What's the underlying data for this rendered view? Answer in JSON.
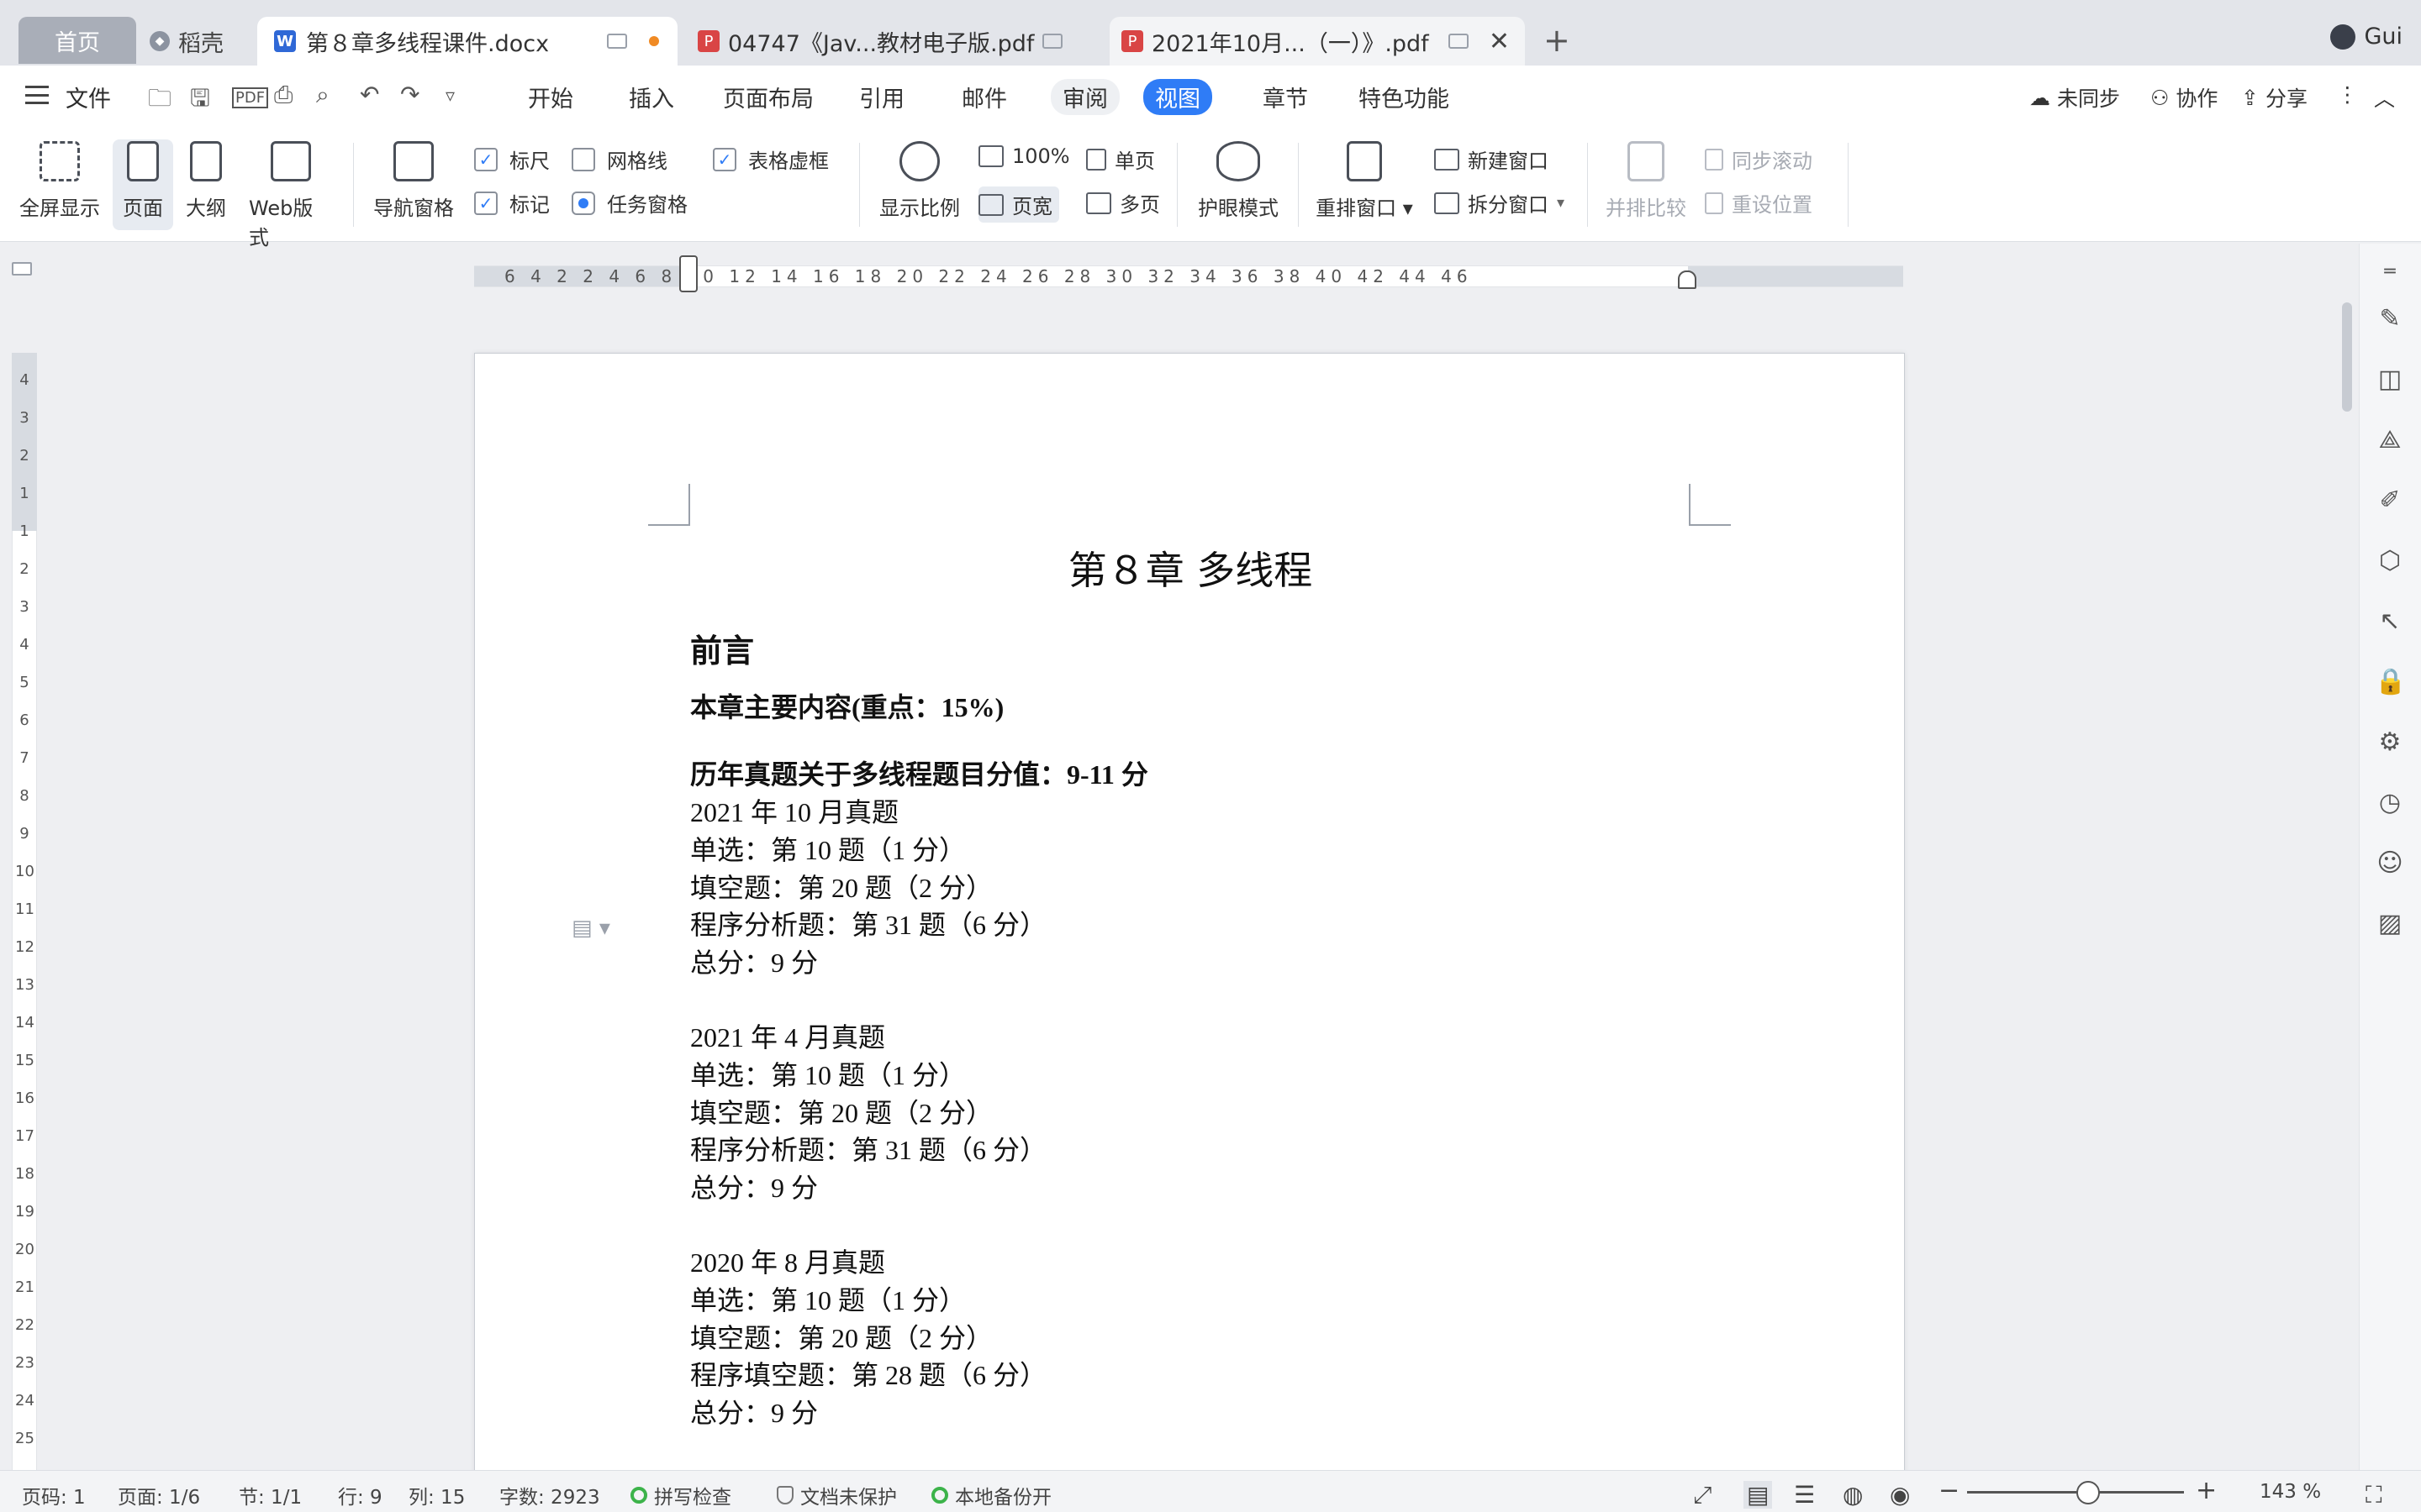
{
  "tabs": {
    "home": "首页",
    "daoke": "稻壳",
    "doc": "第８章多线程课件.docx",
    "pdf1": "04747《Jav...教材电子版.pdf",
    "pdf2": "2021年10月...（一）》.pdf",
    "new_tab": "+",
    "user": "Gui"
  },
  "menu": {
    "file": "文件",
    "items": [
      "开始",
      "插入",
      "页面布局",
      "引用",
      "邮件",
      "审阅",
      "视图",
      "章节",
      "特色功能"
    ],
    "active": "视图",
    "sync": "未同步",
    "collab": "协作",
    "share": "分享"
  },
  "ribbon": {
    "fullscreen": "全屏显示",
    "page": "页面",
    "outline": "大纲",
    "web": "Web版式",
    "nav_pane": "导航窗格",
    "ruler": "标尺",
    "gridlines": "网格线",
    "table_grid": "表格虚框",
    "marks": "标记",
    "task_pane": "任务窗格",
    "zoom": "显示比例",
    "hundred": "100%",
    "page_width": "页宽",
    "single_page": "单页",
    "multi_page": "多页",
    "eye_mode": "护眼模式",
    "rearrange": "重排窗口",
    "new_window": "新建窗口",
    "split_window": "拆分窗口",
    "side_by_side": "并排比较",
    "sync_scroll": "同步滚动",
    "reset_position": "重设位置"
  },
  "ruler": {
    "h_numbers": "6  4  2    2  4  6  8  10  12  14  16  18  20  22  24  26  28  30  32  34  36  38  40  42  44  46",
    "v_numbers": [
      "4",
      "3",
      "2",
      "1",
      "",
      "1",
      "2",
      "3",
      "4",
      "5",
      "6",
      "7",
      "8",
      "9",
      "10",
      "11",
      "12",
      "13",
      "14",
      "15",
      "16",
      "17",
      "18",
      "19",
      "20",
      "21",
      "22",
      "23",
      "24",
      "25"
    ]
  },
  "document": {
    "title": "第８章 多线程",
    "heading": "前言",
    "subheading1": "本章主要内容(重点：15%)",
    "subheading2": "历年真题关于多线程题目分值：9-11 分",
    "sections": [
      {
        "lines": [
          "2021 年 10 月真题",
          "单选：第 10 题（1 分）",
          "填空题：第 20 题（2 分）",
          "程序分析题：第 31 题（6 分）",
          "总分：9 分"
        ]
      },
      {
        "lines": [
          "2021 年 4 月真题",
          "单选：第 10 题（1 分）",
          "填空题：第 20 题（2 分）",
          "程序分析题：第 31 题（6 分）",
          "总分：9 分"
        ]
      },
      {
        "lines": [
          "2020 年 8 月真题",
          "单选：第 10 题（1 分）",
          "填空题：第 20 题（2 分）",
          "程序填空题：第 28 题（6 分）",
          "总分：9 分"
        ]
      }
    ]
  },
  "status": {
    "page_code": "页码: 1",
    "page": "页面: 1/6",
    "section": "节: 1/1",
    "row": "行: 9",
    "col": "列: 15",
    "word_count": "字数: 2923",
    "spell_check": "拼写检查",
    "doc_unprotected": "文档未保护",
    "local_backup": "本地备份开",
    "zoom": "143 %"
  },
  "colors": {
    "accent": "#2f7cf6",
    "word_icon": "#2f68d6",
    "pdf_icon": "#d94545",
    "ok_green": "#3cb34a"
  }
}
